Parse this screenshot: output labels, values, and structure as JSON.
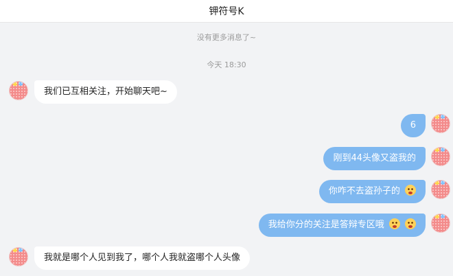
{
  "header": {
    "title": "钾符号K"
  },
  "system": {
    "no_more": "没有更多消息了~",
    "timestamp": "今天 18:30"
  },
  "messages": [
    {
      "side": "left",
      "text": "我们已互相关注，开始聊天吧~"
    },
    {
      "side": "right",
      "text": "6"
    },
    {
      "side": "right",
      "text": "刚到44头像又盗我的"
    },
    {
      "side": "right",
      "text": "你咋不去盗孙子的",
      "emojis": [
        "shocked-emoji"
      ]
    },
    {
      "side": "right",
      "text": "我给你分的关注是答辩专区哦",
      "emojis": [
        "dizzy-emoji",
        "shocked-emoji"
      ]
    },
    {
      "side": "left",
      "text": "我就是哪个人见到我了，哪个人我就盗哪个人头像"
    }
  ]
}
